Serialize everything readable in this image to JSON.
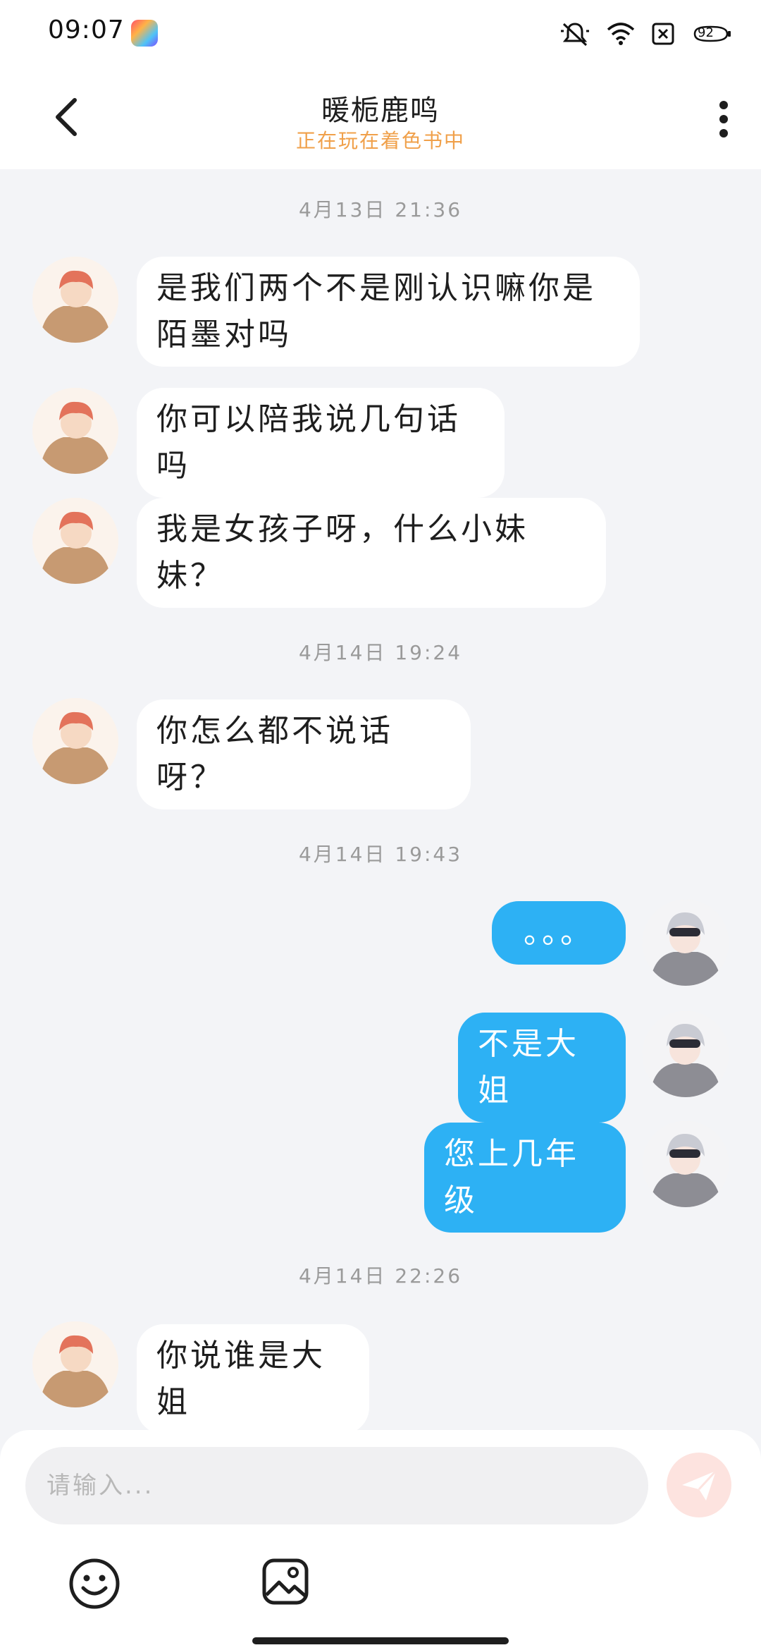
{
  "status_bar": {
    "time": "09:07",
    "battery": "92",
    "icons": [
      "app-icon",
      "mute-icon",
      "wifi-icon",
      "sim-off-icon",
      "battery-icon"
    ]
  },
  "header": {
    "title": "暖栀鹿鸣",
    "subtitle": "正在玩在着色书中"
  },
  "messages": [
    {
      "type": "timestamp",
      "text": "4月13日 21:36"
    },
    {
      "type": "incoming",
      "text": "是我们两个不是刚认识嘛你是陌墨对吗"
    },
    {
      "type": "incoming",
      "text": "你可以陪我说几句话吗"
    },
    {
      "type": "incoming",
      "text": "我是女孩子呀，什么小妹妹？"
    },
    {
      "type": "timestamp",
      "text": "4月14日 19:24"
    },
    {
      "type": "incoming",
      "text": "你怎么都不说话呀？"
    },
    {
      "type": "timestamp",
      "text": "4月14日 19:43"
    },
    {
      "type": "outgoing",
      "text": "。。。"
    },
    {
      "type": "outgoing",
      "text": "不是大姐"
    },
    {
      "type": "outgoing",
      "text": "您上几年级"
    },
    {
      "type": "timestamp",
      "text": "4月14日 22:26"
    },
    {
      "type": "incoming",
      "text": "你说谁是大姐"
    }
  ],
  "composer": {
    "placeholder": "请输入..."
  },
  "colors": {
    "outgoing_bubble": "#2db1f4",
    "incoming_bubble": "#ffffff",
    "subtitle": "#f0a04a",
    "background": "#f3f4f7"
  }
}
